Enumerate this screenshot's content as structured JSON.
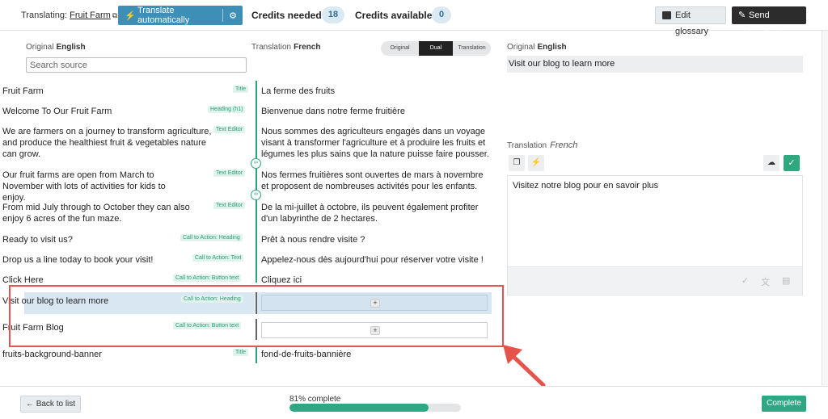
{
  "topbar": {
    "translating_label": "Translating:",
    "project_name": "Fruit Farm",
    "translate_auto_label": "Translate automatically",
    "credits_needed_label": "Credits needed",
    "credits_needed_value": "18",
    "credits_available_label": "Credits available",
    "credits_available_value": "0",
    "edit_glossary_label": "Edit glossary",
    "send_feedback_label": "Send feedback"
  },
  "left_panel": {
    "original_label": "Original",
    "original_lang": "English",
    "translation_label": "Translation",
    "translation_lang": "French",
    "search_placeholder": "Search source",
    "view_toggle": [
      "Original",
      "Dual",
      "Translation"
    ],
    "view_toggle_active": "Dual"
  },
  "rows": [
    {
      "source": "Fruit Farm",
      "tag": "Title",
      "translation": "La ferme des fruits"
    },
    {
      "source": "Welcome To Our Fruit Farm",
      "tag": "Heading (h1)",
      "translation": "Bienvenue dans notre ferme fruitière"
    },
    {
      "source": "We are farmers on a journey to transform agriculture, and produce the healthiest fruit & vegetables nature can grow.",
      "tag": "Text Editor",
      "translation": "Nous sommes des agriculteurs engagés dans un voyage visant à transformer l'agriculture et à produire les fruits et légumes les plus sains que la nature puisse faire pousser."
    },
    {
      "source": "Our fruit farms are open from March to November with lots of activities for kids to enjoy.",
      "tag": "Text Editor",
      "translation": "Nos fermes fruitières sont ouvertes de mars à novembre et proposent de nombreuses activités pour les enfants."
    },
    {
      "source": "From mid July through to October they can also enjoy 6 acres of the fun maze.",
      "tag": "Text Editor",
      "translation": "De la mi-juillet à octobre, ils peuvent également profiter d'un labyrinthe de 2 hectares."
    },
    {
      "source": "Ready to visit us?",
      "tag": "Call to Action: Heading",
      "translation": "Prêt à nous rendre visite ?"
    },
    {
      "source": "Drop us a line today to book your visit!",
      "tag": "Call to Action: Text",
      "translation": "Appelez-nous dès aujourd'hui pour réserver votre visite !"
    },
    {
      "source": "Click Here",
      "tag": "Call to Action: Button text",
      "translation": "Cliquez ici"
    },
    {
      "source": "Visit our blog to learn more",
      "tag": "Call to Action: Heading",
      "translation": ""
    },
    {
      "source": "Fruit Farm Blog",
      "tag": "Call to Action: Button text",
      "translation": ""
    },
    {
      "source": "fruits-background-banner",
      "tag": "Title",
      "translation": "fond-de-fruits-bannière"
    }
  ],
  "right_panel": {
    "original_label": "Original",
    "original_lang": "English",
    "original_text": "Visit our blog to learn more",
    "translation_label": "Translation",
    "translation_lang": "French",
    "translation_text": "Visitez notre blog pour en savoir plus"
  },
  "bottombar": {
    "back_label": "← Back to list",
    "progress_label": "81% complete",
    "progress_value": 0.81,
    "complete_label": "Complete"
  },
  "colors": {
    "accent_blue": "#3d8fb8",
    "accent_green": "#2fa783",
    "highlight_red": "#e5534b"
  }
}
